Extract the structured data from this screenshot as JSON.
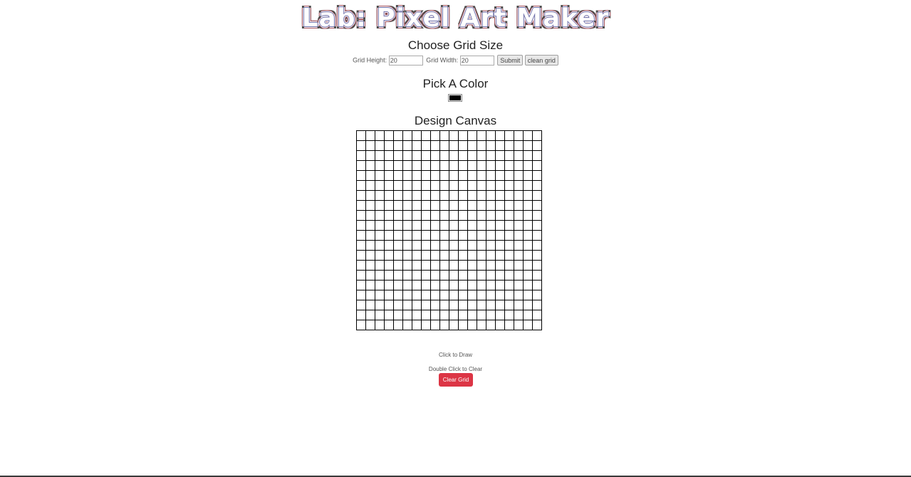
{
  "title": "Lab: Pixel Art Maker",
  "grid_size": {
    "heading": "Choose Grid Size",
    "height_label": "Grid Height:",
    "height_value": "20",
    "width_label": "Grid Width:",
    "width_value": "20",
    "submit_label": "Submit",
    "clean_label": "clean grid"
  },
  "color": {
    "heading": "Pick A Color",
    "value": "#000000"
  },
  "canvas": {
    "heading": "Design Canvas",
    "rows": 20,
    "cols": 20,
    "cell_color": "#ffffff",
    "border_color": "#000000"
  },
  "hints": {
    "draw": "Click to Draw",
    "clear": "Double Click to Clear"
  },
  "clear_button": {
    "label": "Clear Grid",
    "color": "#dc3545"
  }
}
